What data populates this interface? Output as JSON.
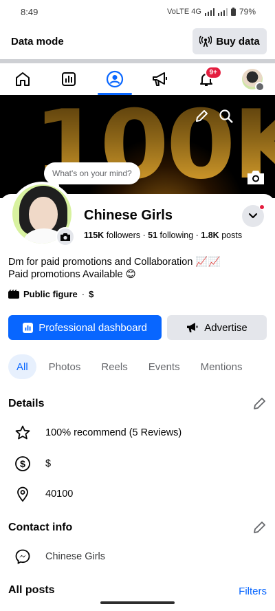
{
  "status_bar": {
    "time": "8:49",
    "network": "VoLTE 4G",
    "battery": "79%"
  },
  "data_mode": {
    "label": "Data mode",
    "buy_label": "Buy data"
  },
  "nav": {
    "notifications_badge": "9+"
  },
  "cover": {
    "text": "100K"
  },
  "composer_bubble": "What's on your mind?",
  "profile": {
    "name": "Chinese Girls",
    "followers_count": "115K",
    "followers_label": "followers",
    "following_count": "51",
    "following_label": "following",
    "posts_count": "1.8K",
    "posts_label": "posts",
    "bio_line1": "Dm for paid promotions and Collaboration 📈📈",
    "bio_line2": "Paid promotions Available 😊",
    "category": "Public figure",
    "price_range": "$"
  },
  "actions": {
    "dashboard_label": "Professional dashboard",
    "advertise_label": "Advertise"
  },
  "tabs": [
    "All",
    "Photos",
    "Reels",
    "Events",
    "Mentions"
  ],
  "details": {
    "title": "Details",
    "recommend": "100% recommend (5 Reviews)",
    "price": "$",
    "location": "40100"
  },
  "contact": {
    "title": "Contact info",
    "messenger": "Chinese Girls"
  },
  "posts": {
    "title": "All posts",
    "filters_label": "Filters"
  },
  "colors": {
    "accent": "#0866ff",
    "badge": "#e41e3f",
    "button_grey": "#e4e6eb"
  }
}
